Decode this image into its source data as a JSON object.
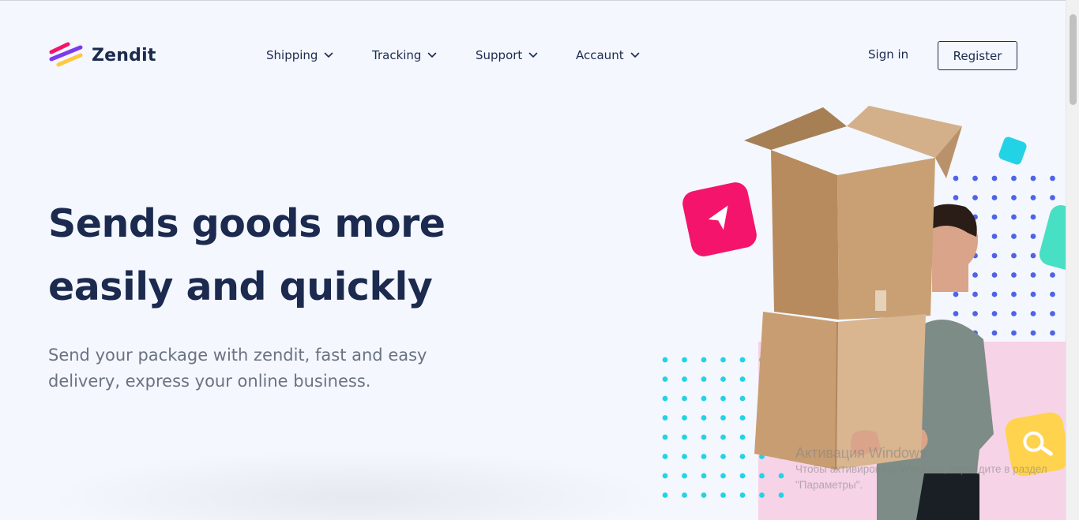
{
  "brand": {
    "name": "Zendit"
  },
  "nav": {
    "items": [
      {
        "label": "Shipping"
      },
      {
        "label": "Tracking"
      },
      {
        "label": "Support"
      },
      {
        "label": "Accaunt"
      }
    ]
  },
  "auth": {
    "signin_label": "Sign in",
    "register_label": "Register"
  },
  "hero": {
    "title": "Sends goods more easily and quickly",
    "subtitle": "Send your package with zendit, fast and easy delivery, express your online business."
  },
  "colors": {
    "primary_text": "#1b2a4e",
    "muted_text": "#6b7280",
    "background": "#f4f7fe",
    "pink_accent": "#f5146b",
    "teal_accent": "#22d3e6",
    "yellow_accent": "#ffd34e",
    "blue_dots": "#4f63e7",
    "pink_panel": "#f6d3e6"
  },
  "icons": {
    "logo": "zendit-logo-icon",
    "dropdown": "chevron-down-icon",
    "send": "paper-plane-icon",
    "search": "search-icon"
  },
  "os_watermark": {
    "line1": "Активация Windows",
    "line2": "Чтобы активировать Windows, перейдите в раздел \"Параметры\"."
  }
}
